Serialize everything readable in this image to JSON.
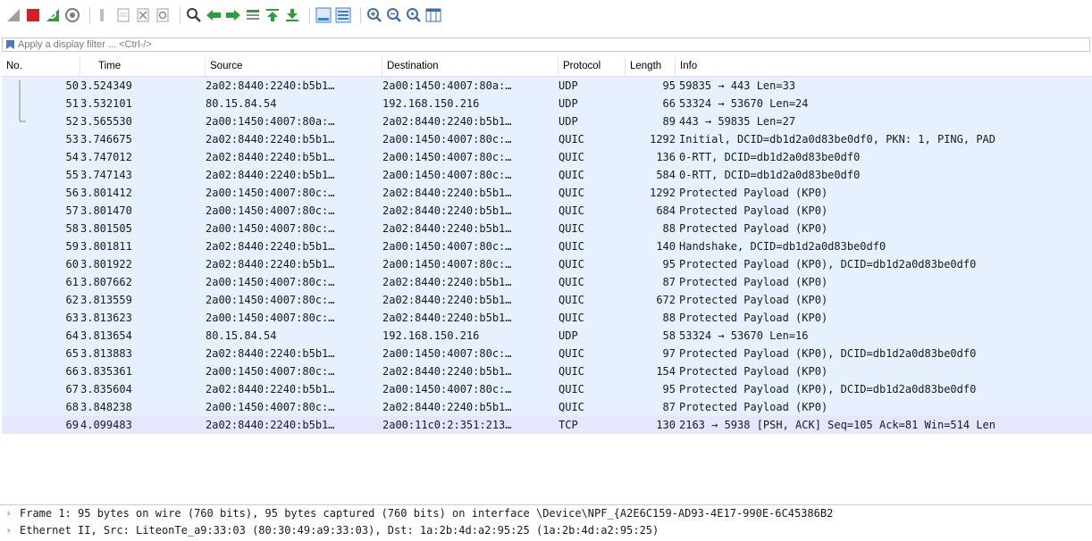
{
  "filter": {
    "placeholder": "Apply a display filter ... <Ctrl-/>"
  },
  "toolbar": {
    "buttons": [
      {
        "name": "start-capture-fin-icon",
        "color": "#9aa0a6"
      },
      {
        "name": "stop-capture-icon",
        "color": "#d32020"
      },
      {
        "name": "restart-capture-icon",
        "color": "#2e9e3a"
      },
      {
        "name": "capture-options-icon",
        "color": "#7a7a7a"
      },
      {
        "name": "open-file-icon",
        "color": "#bfbfbf"
      },
      {
        "name": "save-file-icon",
        "color": "#bfbfbf"
      },
      {
        "name": "close-file-icon",
        "color": "#bfbfbf"
      },
      {
        "name": "reload-file-icon",
        "color": "#bfbfbf"
      },
      {
        "name": "find-packet-icon",
        "color": "#3a3a3a"
      },
      {
        "name": "go-back-icon",
        "color": "#2e9e3a"
      },
      {
        "name": "go-forward-icon",
        "color": "#2e9e3a"
      },
      {
        "name": "go-to-packet-icon",
        "color": "#2e9e3a"
      },
      {
        "name": "go-first-packet-icon",
        "color": "#2e9e3a"
      },
      {
        "name": "go-last-packet-icon",
        "color": "#2e9e3a"
      },
      {
        "name": "auto-scroll-icon",
        "color": "#3d7fd0"
      },
      {
        "name": "colorize-icon",
        "color": "#3d7fd0"
      },
      {
        "name": "zoom-in-icon",
        "color": "#3a6fb0"
      },
      {
        "name": "zoom-out-icon",
        "color": "#3a6fb0"
      },
      {
        "name": "zoom-normal-icon",
        "color": "#3a6fb0"
      },
      {
        "name": "resize-columns-icon",
        "color": "#3a6fb0"
      }
    ]
  },
  "packet_list": {
    "columns": [
      "No.",
      "Time",
      "Source",
      "Destination",
      "Protocol",
      "Length",
      "Info"
    ],
    "row_colors": {
      "default": "#e6f0ff",
      "tcp": "#e7e6ff"
    },
    "rows": [
      {
        "no": "50",
        "time": "3.524349",
        "src": "2a02:8440:2240:b5b1…",
        "dst": "2a00:1450:4007:80a:…",
        "proto": "UDP",
        "len": "95",
        "info": "59835 → 443 Len=33"
      },
      {
        "no": "51",
        "time": "3.532101",
        "src": "80.15.84.54",
        "dst": "192.168.150.216",
        "proto": "UDP",
        "len": "66",
        "info": "53324 → 53670 Len=24"
      },
      {
        "no": "52",
        "time": "3.565530",
        "src": "2a00:1450:4007:80a:…",
        "dst": "2a02:8440:2240:b5b1…",
        "proto": "UDP",
        "len": "89",
        "info": "443 → 59835 Len=27"
      },
      {
        "no": "53",
        "time": "3.746675",
        "src": "2a02:8440:2240:b5b1…",
        "dst": "2a00:1450:4007:80c:…",
        "proto": "QUIC",
        "len": "1292",
        "info": "Initial, DCID=db1d2a0d83be0df0, PKN: 1, PING, PAD"
      },
      {
        "no": "54",
        "time": "3.747012",
        "src": "2a02:8440:2240:b5b1…",
        "dst": "2a00:1450:4007:80c:…",
        "proto": "QUIC",
        "len": "136",
        "info": "0-RTT, DCID=db1d2a0d83be0df0"
      },
      {
        "no": "55",
        "time": "3.747143",
        "src": "2a02:8440:2240:b5b1…",
        "dst": "2a00:1450:4007:80c:…",
        "proto": "QUIC",
        "len": "584",
        "info": "0-RTT, DCID=db1d2a0d83be0df0"
      },
      {
        "no": "56",
        "time": "3.801412",
        "src": "2a00:1450:4007:80c:…",
        "dst": "2a02:8440:2240:b5b1…",
        "proto": "QUIC",
        "len": "1292",
        "info": "Protected Payload (KP0)"
      },
      {
        "no": "57",
        "time": "3.801470",
        "src": "2a00:1450:4007:80c:…",
        "dst": "2a02:8440:2240:b5b1…",
        "proto": "QUIC",
        "len": "684",
        "info": "Protected Payload (KP0)"
      },
      {
        "no": "58",
        "time": "3.801505",
        "src": "2a00:1450:4007:80c:…",
        "dst": "2a02:8440:2240:b5b1…",
        "proto": "QUIC",
        "len": "88",
        "info": "Protected Payload (KP0)"
      },
      {
        "no": "59",
        "time": "3.801811",
        "src": "2a02:8440:2240:b5b1…",
        "dst": "2a00:1450:4007:80c:…",
        "proto": "QUIC",
        "len": "140",
        "info": "Handshake, DCID=db1d2a0d83be0df0"
      },
      {
        "no": "60",
        "time": "3.801922",
        "src": "2a02:8440:2240:b5b1…",
        "dst": "2a00:1450:4007:80c:…",
        "proto": "QUIC",
        "len": "95",
        "info": "Protected Payload (KP0), DCID=db1d2a0d83be0df0"
      },
      {
        "no": "61",
        "time": "3.807662",
        "src": "2a00:1450:4007:80c:…",
        "dst": "2a02:8440:2240:b5b1…",
        "proto": "QUIC",
        "len": "87",
        "info": "Protected Payload (KP0)"
      },
      {
        "no": "62",
        "time": "3.813559",
        "src": "2a00:1450:4007:80c:…",
        "dst": "2a02:8440:2240:b5b1…",
        "proto": "QUIC",
        "len": "672",
        "info": "Protected Payload (KP0)"
      },
      {
        "no": "63",
        "time": "3.813623",
        "src": "2a00:1450:4007:80c:…",
        "dst": "2a02:8440:2240:b5b1…",
        "proto": "QUIC",
        "len": "88",
        "info": "Protected Payload (KP0)"
      },
      {
        "no": "64",
        "time": "3.813654",
        "src": "80.15.84.54",
        "dst": "192.168.150.216",
        "proto": "UDP",
        "len": "58",
        "info": "53324 → 53670 Len=16"
      },
      {
        "no": "65",
        "time": "3.813883",
        "src": "2a02:8440:2240:b5b1…",
        "dst": "2a00:1450:4007:80c:…",
        "proto": "QUIC",
        "len": "97",
        "info": "Protected Payload (KP0), DCID=db1d2a0d83be0df0"
      },
      {
        "no": "66",
        "time": "3.835361",
        "src": "2a00:1450:4007:80c:…",
        "dst": "2a02:8440:2240:b5b1…",
        "proto": "QUIC",
        "len": "154",
        "info": "Protected Payload (KP0)"
      },
      {
        "no": "67",
        "time": "3.835604",
        "src": "2a02:8440:2240:b5b1…",
        "dst": "2a00:1450:4007:80c:…",
        "proto": "QUIC",
        "len": "95",
        "info": "Protected Payload (KP0), DCID=db1d2a0d83be0df0"
      },
      {
        "no": "68",
        "time": "3.848238",
        "src": "2a00:1450:4007:80c:…",
        "dst": "2a02:8440:2240:b5b1…",
        "proto": "QUIC",
        "len": "87",
        "info": "Protected Payload (KP0)"
      },
      {
        "no": "69",
        "time": "4.099483",
        "src": "2a02:8440:2240:b5b1…",
        "dst": "2a00:11c0:2:351:213…",
        "proto": "TCP",
        "len": "130",
        "info": "2163 → 5938 [PSH, ACK] Seq=105 Ack=81 Win=514 Len"
      }
    ]
  },
  "details": [
    {
      "text": "Frame 1: 95 bytes on wire (760 bits), 95 bytes captured (760 bits) on interface \\Device\\NPF_{A2E6C159-AD93-4E17-990E-6C45386B2"
    },
    {
      "text": "Ethernet II, Src: LiteonTe_a9:33:03 (80:30:49:a9:33:03), Dst: 1a:2b:4d:a2:95:25 (1a:2b:4d:a2:95:25)"
    }
  ]
}
